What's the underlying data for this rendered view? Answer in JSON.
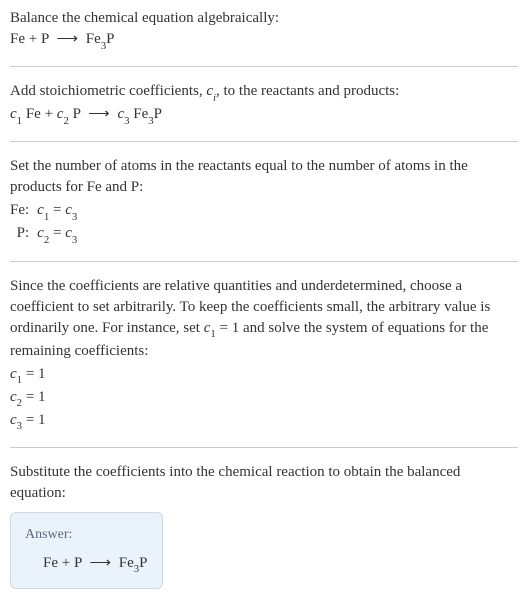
{
  "section1": {
    "intro": "Balance the chemical equation algebraically:",
    "eq_lhs1": "Fe + P",
    "eq_arrow": "⟶",
    "eq_rhs_fe": "Fe",
    "eq_rhs_sub": "3",
    "eq_rhs_p": "P"
  },
  "section2": {
    "intro_a": "Add stoichiometric coefficients, ",
    "intro_ci": "c",
    "intro_ci_sub": "i",
    "intro_b": ", to the reactants and products:",
    "c1": "c",
    "c1s": "1",
    "sp1": " Fe + ",
    "c2": "c",
    "c2s": "2",
    "sp2": " P",
    "arrow": "⟶",
    "c3": "c",
    "c3s": "3",
    "sp3": " Fe",
    "fe3s": "3",
    "sp4": "P"
  },
  "section3": {
    "intro": "Set the number of atoms in the reactants equal to the number of atoms in the products for Fe and P:",
    "rows": [
      {
        "label": "Fe:",
        "lhs_c": "c",
        "lhs_s": "1",
        "eq": " = ",
        "rhs_c": "c",
        "rhs_s": "3"
      },
      {
        "label": "P:",
        "lhs_c": "c",
        "lhs_s": "2",
        "eq": " = ",
        "rhs_c": "c",
        "rhs_s": "3"
      }
    ]
  },
  "section4": {
    "intro_a": "Since the coefficients are relative quantities and underdetermined, choose a coefficient to set arbitrarily. To keep the coefficients small, the arbitrary value is ordinarily one. For instance, set ",
    "cvar": "c",
    "csub": "1",
    "ceq": " = 1",
    "intro_b": " and solve the system of equations for the remaining coefficients:",
    "coefs": [
      {
        "c": "c",
        "s": "1",
        "v": " = 1"
      },
      {
        "c": "c",
        "s": "2",
        "v": " = 1"
      },
      {
        "c": "c",
        "s": "3",
        "v": " = 1"
      }
    ]
  },
  "section5": {
    "intro": "Substitute the coefficients into the chemical reaction to obtain the balanced equation:",
    "answer_label": "Answer:",
    "eq_lhs": "Fe + P",
    "arrow": "⟶",
    "eq_rhs_fe": "Fe",
    "eq_rhs_sub": "3",
    "eq_rhs_p": "P"
  },
  "chart_data": {
    "type": "table",
    "title": "Balancing chemical equation Fe + P → Fe3P",
    "unbalanced_equation": "Fe + P → Fe3P",
    "coefficient_equations": [
      {
        "element": "Fe",
        "equation": "c1 = c3"
      },
      {
        "element": "P",
        "equation": "c2 = c3"
      }
    ],
    "solution": {
      "c1": 1,
      "c2": 1,
      "c3": 1
    },
    "balanced_equation": "Fe + P → Fe3P"
  }
}
